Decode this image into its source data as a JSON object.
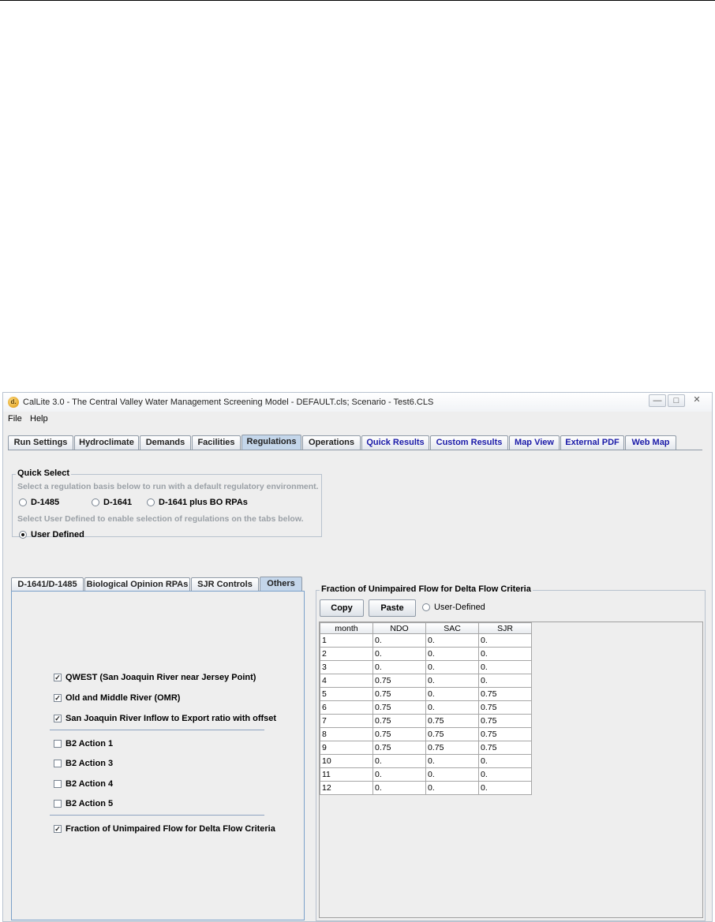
{
  "window": {
    "title": "CalLite 3.0 -  The Central Valley Water Management Screening Model - DEFAULT.cls;  Scenario - Test6.CLS",
    "app_icon_text": "d."
  },
  "menu": {
    "file": "File",
    "help": "Help"
  },
  "main_tabs": [
    "Run Settings",
    "Hydroclimate",
    "Demands",
    "Facilities",
    "Regulations",
    "Operations",
    "Quick Results",
    "Custom Results",
    "Map View",
    "External PDF",
    "Web Map"
  ],
  "quick_select": {
    "title": "Quick Select",
    "instruction1": "Select a regulation basis below to run with a default regulatory environment.",
    "options": [
      "D-1485",
      "D-1641",
      "D-1641 plus BO RPAs"
    ],
    "instruction2": "Select User Defined to enable selection of regulations on the tabs below.",
    "user_defined": "User Defined"
  },
  "sub_tabs": [
    "D-1641/D-1485",
    "Biological Opinion RPAs",
    "SJR Controls",
    "Others"
  ],
  "checkboxes": {
    "qwest": "QWEST (San Joaquin River near Jersey Point)",
    "omr": "Old and Middle River (OMR)",
    "sjr_ratio": "San Joaquin River Inflow to Export ratio with offset",
    "b2_1": "B2 Action 1",
    "b2_3": "B2 Action 3",
    "b2_4": "B2 Action 4",
    "b2_5": "B2 Action 5",
    "fraction": "Fraction of Unimpaired Flow for Delta Flow Criteria"
  },
  "right_panel": {
    "title": "Fraction of Unimpaired Flow for Delta Flow Criteria",
    "copy": "Copy",
    "paste": "Paste",
    "user_defined": "User-Defined",
    "columns": [
      "month",
      "NDO",
      "SAC",
      "SJR"
    ],
    "rows": [
      [
        "1",
        "0.",
        "0.",
        "0."
      ],
      [
        "2",
        "0.",
        "0.",
        "0."
      ],
      [
        "3",
        "0.",
        "0.",
        "0."
      ],
      [
        "4",
        "0.75",
        "0.",
        "0."
      ],
      [
        "5",
        "0.75",
        "0.",
        "0.75"
      ],
      [
        "6",
        "0.75",
        "0.",
        "0.75"
      ],
      [
        "7",
        "0.75",
        "0.75",
        "0.75"
      ],
      [
        "8",
        "0.75",
        "0.75",
        "0.75"
      ],
      [
        "9",
        "0.75",
        "0.75",
        "0.75"
      ],
      [
        "10",
        "0.",
        "0.",
        "0."
      ],
      [
        "11",
        "0.",
        "0.",
        "0."
      ],
      [
        "12",
        "0.",
        "0.",
        "0."
      ]
    ]
  }
}
